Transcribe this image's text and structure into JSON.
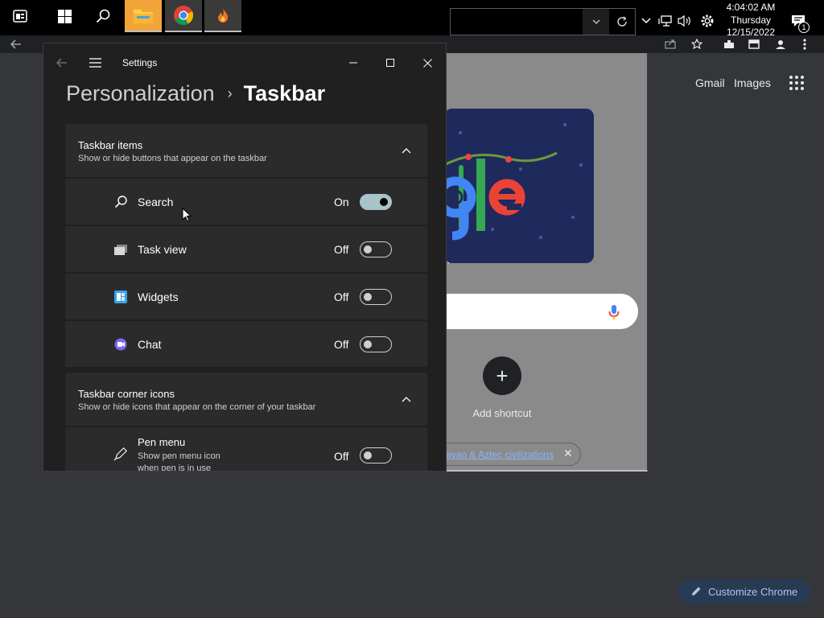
{
  "taskbar": {
    "clock": {
      "time": "4:04:02 AM",
      "day": "Thursday",
      "date": "12/15/2022"
    },
    "notification_count": "1"
  },
  "chrome": {
    "header_links": {
      "gmail": "Gmail",
      "images": "Images"
    },
    "shortcut": {
      "label": "Add shortcut",
      "plus": "+"
    },
    "chip": {
      "text": "ayan & Aztec civilizations",
      "close": "✕"
    },
    "customize_label": "Customize Chrome"
  },
  "settings": {
    "window_title": "Settings",
    "breadcrumb": {
      "parent": "Personalization",
      "separator": "›",
      "current": "Taskbar"
    },
    "sections": [
      {
        "title": "Taskbar items",
        "subtitle": "Show or hide buttons that appear on the taskbar",
        "items": [
          {
            "label": "Search",
            "state": "On",
            "icon": "search-icon"
          },
          {
            "label": "Task view",
            "state": "Off",
            "icon": "task-view-icon"
          },
          {
            "label": "Widgets",
            "state": "Off",
            "icon": "widgets-icon"
          },
          {
            "label": "Chat",
            "state": "Off",
            "icon": "chat-icon"
          }
        ]
      },
      {
        "title": "Taskbar corner icons",
        "subtitle": "Show or hide icons that appear on the corner of your taskbar",
        "items": [
          {
            "label": "Pen menu",
            "desc1": "Show pen menu icon",
            "desc2": "when pen is in use",
            "state": "Off",
            "icon": "pen-icon"
          }
        ]
      }
    ]
  },
  "colors": {
    "taskbar_bg": "#000000",
    "settings_bg": "#202020",
    "card_bg": "#2b2b2b",
    "chrome_bg": "#35363a",
    "toggle_on": "#a8c3c9",
    "link_blue": "#8ab4f8"
  }
}
